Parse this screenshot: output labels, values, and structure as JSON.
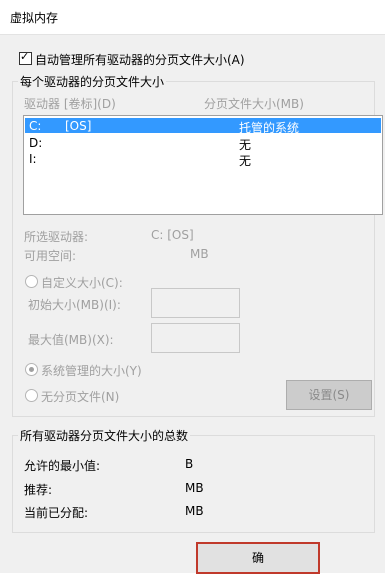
{
  "window": {
    "title": "虚拟内存"
  },
  "auto_manage": {
    "label": "自动管理所有驱动器的分页文件大小(A)",
    "checked": true
  },
  "drives_group": {
    "title": "每个驱动器的分页文件大小",
    "col_drive": "驱动器 [卷标](D)",
    "col_size": "分页文件大小(MB)",
    "rows": [
      {
        "drive": "C:",
        "label": "[OS]",
        "size": "托管的系统",
        "selected": true
      },
      {
        "drive": "D:",
        "label": "",
        "size": "无",
        "selected": false
      },
      {
        "drive": "I:",
        "label": "",
        "size": "无",
        "selected": false
      }
    ],
    "selected_drive_label": "所选驱动器:",
    "selected_drive_value": "C:  [OS]",
    "available_label": "可用空间:",
    "available_value": "MB",
    "custom_size_label": "自定义大小(C):",
    "initial_size_label": "初始大小(MB)(I):",
    "max_size_label": "最大值(MB)(X):",
    "system_managed_label": "系统管理的大小(Y)",
    "no_paging_label": "无分页文件(N)",
    "set_button": "设置(S)"
  },
  "totals_group": {
    "title": "所有驱动器分页文件大小的总数",
    "min_label": "允许的最小值:",
    "min_value": "B",
    "recommended_label": "推荐:",
    "recommended_value": "MB",
    "allocated_label": "当前已分配:",
    "allocated_value": "MB"
  },
  "ok_button": "确"
}
